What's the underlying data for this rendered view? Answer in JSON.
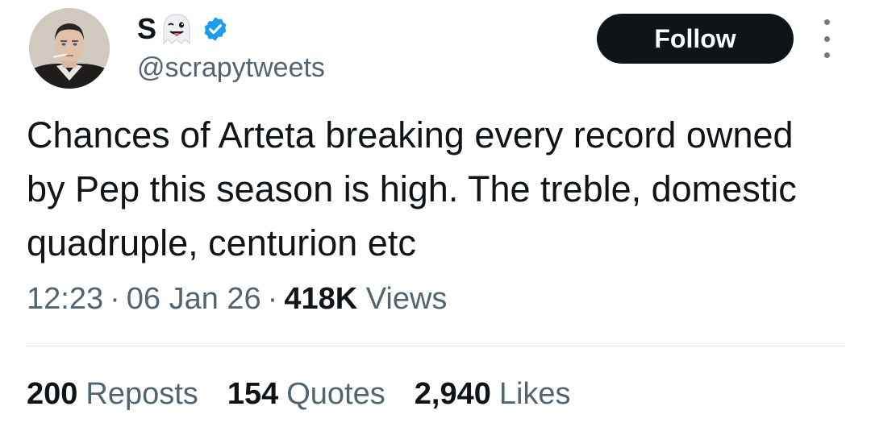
{
  "author": {
    "display_name": "S",
    "emoji_icon": "ghost-tongue-emoji",
    "verified_icon": "verified-badge-icon",
    "handle": "@scrapytweets",
    "avatar_icon": "profile-photo"
  },
  "actions": {
    "follow_label": "Follow",
    "more_icon": "more-vertical-icon"
  },
  "tweet": {
    "text": "Chances of Arteta breaking every record owned by Pep this season is high. The treble, domestic quadruple, centurion etc"
  },
  "meta": {
    "time": "12:23",
    "separator": "·",
    "date": "06 Jan 26",
    "views_count": "418K",
    "views_label": "Views"
  },
  "stats": {
    "reposts_count": "200",
    "reposts_label": "Reposts",
    "quotes_count": "154",
    "quotes_label": "Quotes",
    "likes_count": "2,940",
    "likes_label": "Likes"
  },
  "colors": {
    "text_primary": "#0f1419",
    "text_secondary": "#536471",
    "verified_blue": "#1d9bf0",
    "follow_bg": "#0f1419",
    "divider": "#dfe3e6"
  }
}
